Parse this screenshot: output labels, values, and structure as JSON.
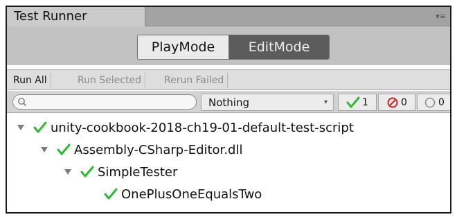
{
  "window": {
    "tab_title": "Test Runner",
    "tab_menu": "▾≡"
  },
  "modes": {
    "play_label": "PlayMode",
    "edit_label": "EditMode",
    "selected": "EditMode"
  },
  "toolbar": {
    "run_all": "Run All",
    "run_selected": "Run Selected",
    "rerun_failed": "Rerun Failed"
  },
  "filter": {
    "search_value": "",
    "category_selected": "Nothing",
    "passed_count": "1",
    "failed_count": "0",
    "skipped_count": "0"
  },
  "tree": {
    "items": [
      {
        "label": "unity-cookbook-2018-ch19-01-default-test-script",
        "status": "passed",
        "expanded": true
      },
      {
        "label": "Assembly-CSharp-Editor.dll",
        "status": "passed",
        "expanded": true
      },
      {
        "label": "SimpleTester",
        "status": "passed",
        "expanded": true
      },
      {
        "label": "OnePlusOneEqualsTwo",
        "status": "passed"
      }
    ]
  },
  "colors": {
    "pass_green": "#2fb82f",
    "fail_red": "#d62020",
    "edit_mode_bg": "#5c5c5c"
  },
  "icons": {
    "search": "search-icon",
    "pass": "check-icon",
    "fail": "failed-icon",
    "skip": "skipped-icon",
    "fold": "triangle-down-icon"
  }
}
